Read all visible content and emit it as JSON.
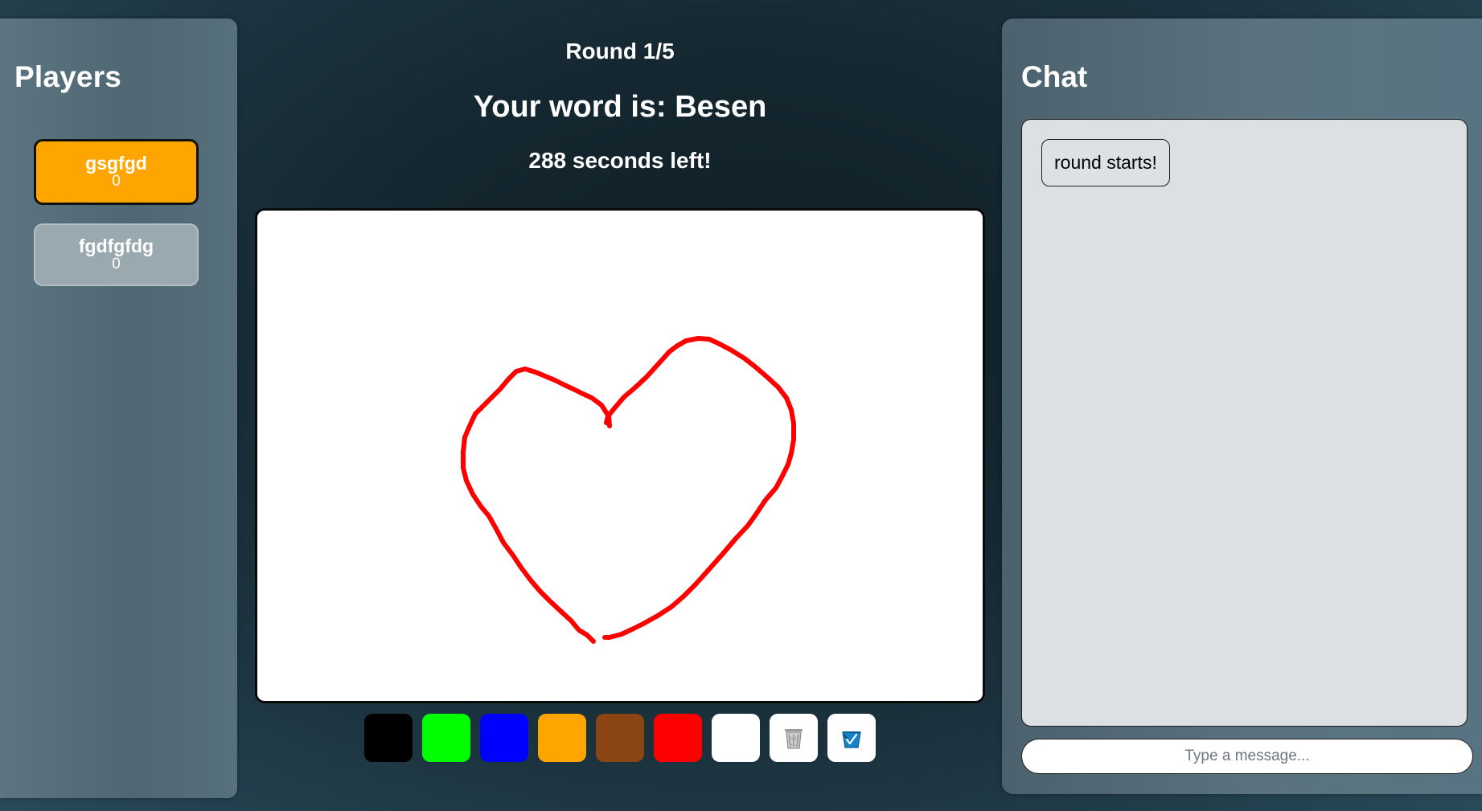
{
  "players": {
    "title": "Players",
    "list": [
      {
        "name": "gsgfgd",
        "score": "0",
        "active": true
      },
      {
        "name": "fgdfgfdg",
        "score": "0",
        "active": false
      }
    ]
  },
  "game": {
    "round": "Round 1/5",
    "word": "Your word is: Besen",
    "timer": "288 seconds left!"
  },
  "toolbar": {
    "colors": [
      {
        "name": "black",
        "hex": "#000000"
      },
      {
        "name": "green",
        "hex": "#00ff00"
      },
      {
        "name": "blue",
        "hex": "#0000ff"
      },
      {
        "name": "orange",
        "hex": "#ffa500"
      },
      {
        "name": "brown",
        "hex": "#8b4513"
      },
      {
        "name": "red",
        "hex": "#ff0000"
      },
      {
        "name": "white",
        "hex": "#ffffff"
      }
    ],
    "tools": [
      "trash-icon",
      "bucket-fill-icon"
    ]
  },
  "drawing": {
    "stroke_color": "#ff0000"
  },
  "chat": {
    "title": "Chat",
    "messages": [
      "round starts!"
    ],
    "placeholder": "Type a message..."
  }
}
